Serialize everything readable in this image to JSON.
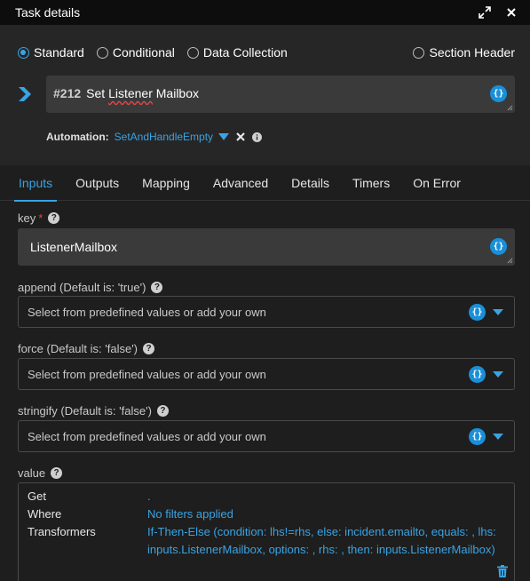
{
  "window": {
    "title": "Task details"
  },
  "task_types": {
    "standard": "Standard",
    "conditional": "Conditional",
    "data_collection": "Data Collection",
    "section_header": "Section Header",
    "selected": "Standard"
  },
  "task": {
    "number": "#212",
    "name_prefix": "Set ",
    "name_underlined": "Listener",
    "name_suffix": " Mailbox"
  },
  "automation": {
    "label": "Automation:",
    "value": "SetAndHandleEmpty"
  },
  "tabs": [
    "Inputs",
    "Outputs",
    "Mapping",
    "Advanced",
    "Details",
    "Timers",
    "On Error"
  ],
  "active_tab": "Inputs",
  "fields": {
    "key": {
      "label": "key",
      "required_mark": "*",
      "value": "ListenerMailbox"
    },
    "append": {
      "label": "append (Default is: 'true')",
      "placeholder": "Select from predefined values or add your own"
    },
    "force": {
      "label": "force (Default is: 'false')",
      "placeholder": "Select from predefined values or add your own"
    },
    "stringify": {
      "label": "stringify (Default is: 'false')",
      "placeholder": "Select from predefined values or add your own"
    },
    "value": {
      "label": "value",
      "get_label": "Get",
      "get_value": ".",
      "where_label": "Where",
      "where_value": "No filters applied",
      "transformers_label": "Transformers",
      "transformers_value": "If-Then-Else (condition: lhs!=rhs, else: incident.emailto, equals: , lhs: inputs.ListenerMailbox, options: , rhs: , then: inputs.ListenerMailbox)"
    }
  },
  "colors": {
    "accent": "#3aa3e3",
    "required": "#e04848",
    "background": "#1e1e1e",
    "titlebar": "#0d0d0d"
  },
  "icons": [
    "expand-icon",
    "close-icon",
    "chevron-right-icon",
    "braces-icon",
    "caret-down-icon",
    "clear-icon",
    "info-icon",
    "help-icon",
    "trash-icon"
  ]
}
